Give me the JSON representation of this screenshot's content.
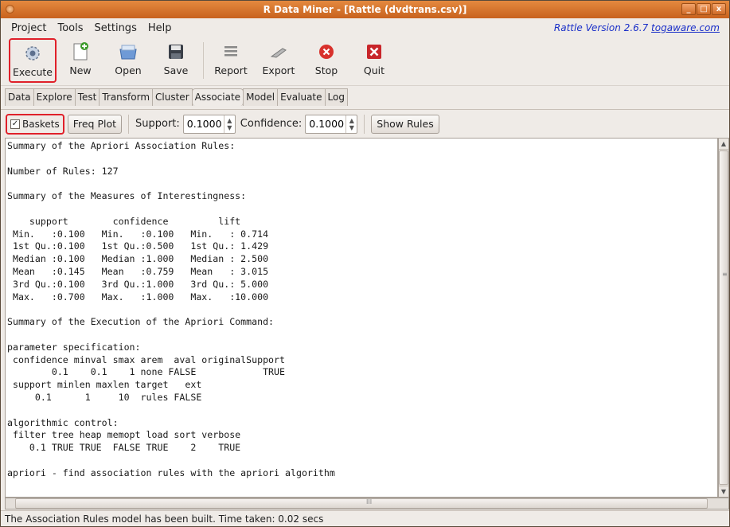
{
  "window": {
    "title": "R Data Miner - [Rattle (dvdtrans.csv)]",
    "controls": [
      "_",
      "□",
      "x"
    ]
  },
  "menubar": {
    "items": [
      "Project",
      "Tools",
      "Settings",
      "Help"
    ],
    "version_prefix": "Rattle Version 2.6.7 ",
    "version_link": "togaware.com"
  },
  "toolbar": {
    "execute": "Execute",
    "new": "New",
    "open": "Open",
    "save": "Save",
    "report": "Report",
    "export": "Export",
    "stop": "Stop",
    "quit": "Quit"
  },
  "tabs": {
    "items": [
      "Data",
      "Explore",
      "Test",
      "Transform",
      "Cluster",
      "Associate",
      "Model",
      "Evaluate",
      "Log"
    ],
    "active": "Associate"
  },
  "options": {
    "baskets_label": "Baskets",
    "baskets_checked": true,
    "freq_plot": "Freq Plot",
    "support_label": "Support:",
    "support_value": "0.1000",
    "confidence_label": "Confidence:",
    "confidence_value": "0.1000",
    "show_rules": "Show Rules"
  },
  "output": {
    "text": "Summary of the Apriori Association Rules:\n\nNumber of Rules: 127\n\nSummary of the Measures of Interestingness:\n\n    support        confidence         lift      \n Min.   :0.100   Min.   :0.100   Min.   : 0.714  \n 1st Qu.:0.100   1st Qu.:0.500   1st Qu.: 1.429  \n Median :0.100   Median :1.000   Median : 2.500  \n Mean   :0.145   Mean   :0.759   Mean   : 3.015  \n 3rd Qu.:0.100   3rd Qu.:1.000   3rd Qu.: 5.000  \n Max.   :0.700   Max.   :1.000   Max.   :10.000  \n\nSummary of the Execution of the Apriori Command:\n\nparameter specification:\n confidence minval smax arem  aval originalSupport\n        0.1    0.1    1 none FALSE            TRUE\n support minlen maxlen target   ext\n     0.1      1     10  rules FALSE\n\nalgorithmic control:\n filter tree heap memopt load sort verbose\n    0.1 TRUE TRUE  FALSE TRUE    2    TRUE\n\napriori - find association rules with the apriori algorithm"
  },
  "status": {
    "text": "The Association Rules model has been built. Time taken: 0.02 secs"
  },
  "colors": {
    "title_bar": "#d7762f",
    "highlight_box": "#e0202a",
    "link": "#1a2fc8"
  }
}
